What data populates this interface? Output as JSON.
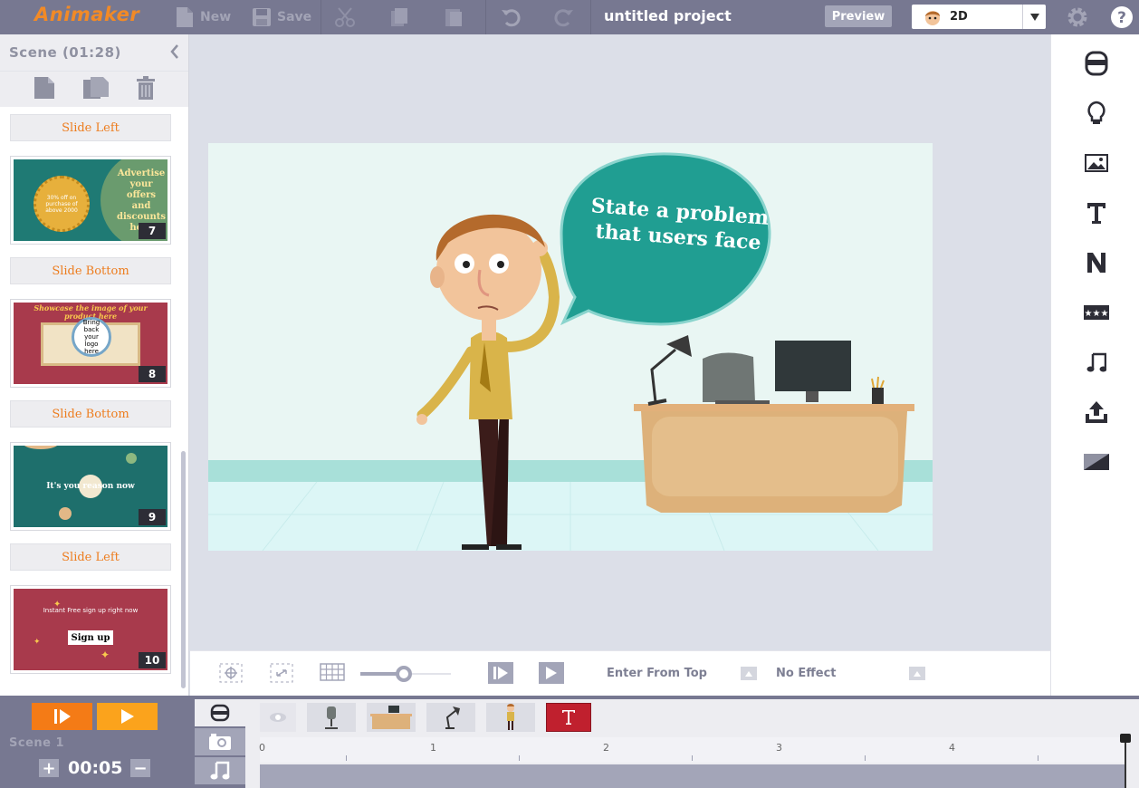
{
  "app": {
    "logo": "Animaker",
    "project_title": "untitled project"
  },
  "toolbar": {
    "new_label": "New",
    "save_label": "Save",
    "preview_label": "Preview",
    "mode_value": "2D"
  },
  "scene_panel": {
    "title": "Scene  (01:28)"
  },
  "slides": [
    {
      "transition": "Slide Left",
      "number": "7",
      "lines": [
        "Advertise",
        "your",
        "offers",
        "and",
        "discounts",
        "here"
      ],
      "badge": "30% off on purchase of above 2000"
    },
    {
      "transition": "Slide Bottom",
      "number": "8",
      "heading": "Showcase the image of your product here",
      "circle": "Bring back your logo here"
    },
    {
      "transition": "Slide Bottom",
      "number": "9",
      "text": "It's you reason now"
    },
    {
      "transition": "Slide Left",
      "number": "10",
      "line1": "Instant Free sign up right now",
      "button": "Sign up"
    }
  ],
  "stage": {
    "bubble_line1": "State a problem",
    "bubble_line2": "that users face"
  },
  "controls": {
    "zoom_fraction": 0.48,
    "enter_effect": "Enter From Top",
    "exit_effect": "No Effect"
  },
  "timeline": {
    "scene_label": "Scene  1",
    "duration": "00:05",
    "ruler_labels": [
      "0",
      "1",
      "2",
      "3",
      "4"
    ]
  },
  "colors": {
    "topbar": "#777891",
    "accent_orange": "#f28a26",
    "teal": "#1f9e91",
    "text_active": "#ffffff"
  }
}
